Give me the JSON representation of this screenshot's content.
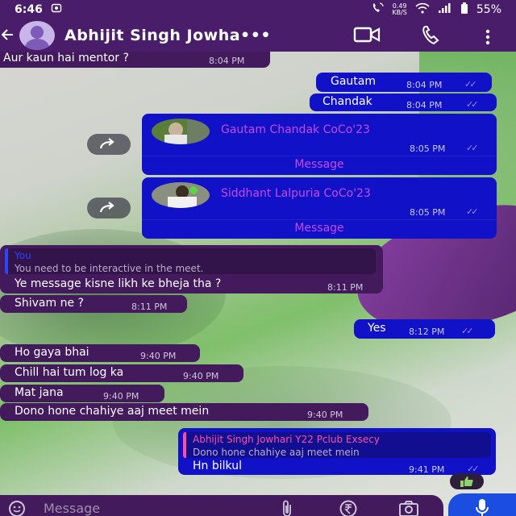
{
  "status_bar": {
    "time": "6:46",
    "net_speed_value": "0.49",
    "net_speed_unit": "KB/S",
    "battery": "55%"
  },
  "header": {
    "contact_name": "Abhijit Singh Jowha•••"
  },
  "messages": [
    {
      "dir": "in",
      "text": "Aur kaun hai mentor ?",
      "time": "8:04 PM"
    },
    {
      "dir": "out",
      "text": "Gautam",
      "time": "8:04 PM"
    },
    {
      "dir": "out",
      "text": "Chandak",
      "time": "8:04 PM"
    },
    {
      "dir": "out",
      "type": "contact",
      "name": "Gautam Chandak CoCo'23",
      "time": "8:05 PM",
      "action": "Message"
    },
    {
      "dir": "out",
      "type": "contact",
      "name": "Siddhant Lalpuria CoCo'23",
      "time": "8:05 PM",
      "action": "Message"
    },
    {
      "dir": "in",
      "quote_name": "You",
      "quote_text": "You need to be interactive in the meet.",
      "text": "Ye message kisne likh ke bheja tha ?",
      "time": "8:11 PM"
    },
    {
      "dir": "in",
      "text": "Shivam ne ?",
      "time": "8:11 PM"
    },
    {
      "dir": "out",
      "text": "Yes",
      "time": "8:12 PM"
    },
    {
      "dir": "in",
      "text": "Ho gaya bhai",
      "time": "9:40 PM"
    },
    {
      "dir": "in",
      "text": "Chill hai tum log ka",
      "time": "9:40 PM"
    },
    {
      "dir": "in",
      "text": "Mat jana",
      "time": "9:40 PM"
    },
    {
      "dir": "in",
      "text": "Dono hone chahiye aaj meet mein",
      "time": "9:40 PM"
    },
    {
      "dir": "out",
      "quote_name": "Abhijit Singh Jowhari Y22 Pclub Exsecy",
      "quote_text": "Dono hone chahiye aaj meet mein",
      "text": "Hn bilkul",
      "time": "9:41 PM",
      "reaction": "thumbs-up"
    }
  ],
  "composer": {
    "placeholder": "Message"
  },
  "colors": {
    "header_bg": "#4a1d6b",
    "incoming_bubble": "#431a5c",
    "outgoing_bubble": "#1111c8",
    "contact_name": "#c44be0",
    "mic_button": "#1a4de0"
  }
}
